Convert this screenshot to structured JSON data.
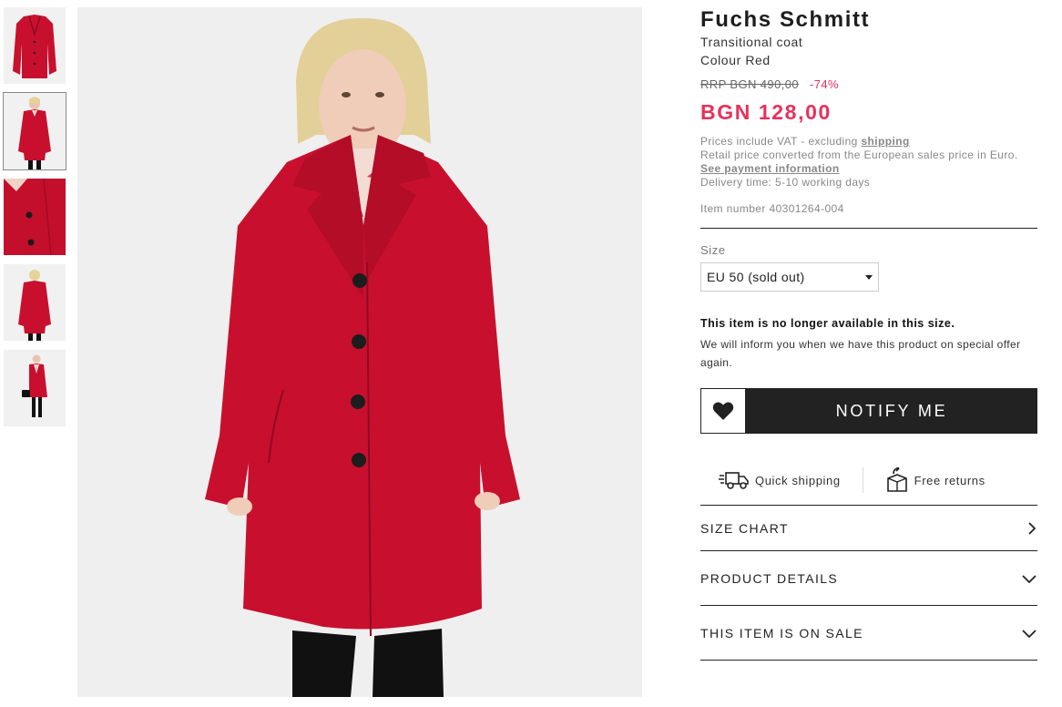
{
  "product": {
    "brand": "Fuchs Schmitt",
    "type": "Transitional coat",
    "colour": "Colour Red",
    "rrp": "RRP BGN 490,00",
    "discount": "-74%",
    "price": "BGN 128,00",
    "vat_note_prefix": "Prices include VAT - excluding ",
    "vat_note_link": "shipping",
    "retail_note": "Retail price converted from the European sales price in Euro.",
    "payment_link": "See payment information",
    "delivery": "Delivery time: 5-10 working days",
    "item_number": "Item number 40301264-004"
  },
  "size": {
    "label": "Size",
    "selected": "EU 50 (sold out)"
  },
  "availability": {
    "heading": "This item is no longer available in this size.",
    "message": "We will inform you when we have this product on special offer again."
  },
  "actions": {
    "notify_label": "NOTIFY ME"
  },
  "perks": {
    "shipping": "Quick shipping",
    "returns": "Free returns"
  },
  "accordion": [
    {
      "label": "SIZE CHART"
    },
    {
      "label": "PRODUCT DETAILS"
    },
    {
      "label": "THIS ITEM IS ON SALE"
    }
  ],
  "icons": {
    "wishlist": "heart-icon",
    "shipping": "truck-icon",
    "returns": "return-box-icon",
    "size_chart": "chevron-right-icon",
    "expand": "chevron-down-icon"
  },
  "colors": {
    "accent_sale": "#e8315b",
    "coat_red": "#c8102e",
    "dark": "#222222"
  }
}
